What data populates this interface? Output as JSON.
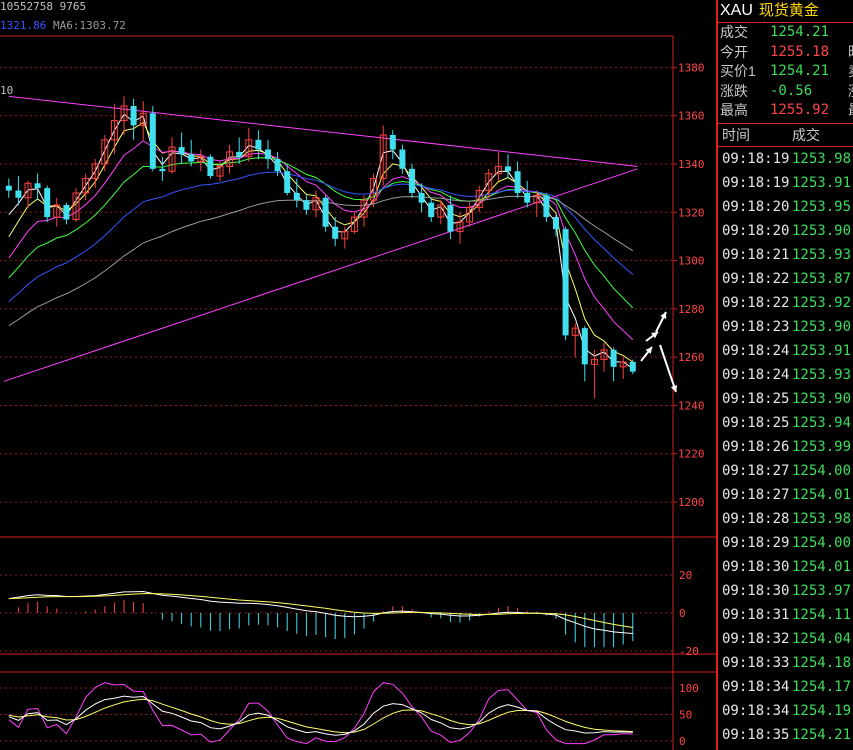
{
  "header": {
    "top_line": "10552758 9765",
    "ma_a_label": "1321.86",
    "ma_b_label": "MA6:1303.72",
    "corner_tag": "10"
  },
  "quote": {
    "code": "XAU",
    "name": "现货黄金",
    "rows": [
      {
        "label": "成交",
        "value": "1254.21",
        "color": "green",
        "clip": ""
      },
      {
        "label": "今开",
        "value": "1255.18",
        "color": "red",
        "clip": "昨"
      },
      {
        "label": "买价1",
        "value": "1254.21",
        "color": "green",
        "clip": "卖"
      },
      {
        "label": "涨跌",
        "value": "-0.56",
        "color": "green",
        "clip": "涨"
      },
      {
        "label": "最高",
        "value": "1255.92",
        "color": "red",
        "clip": "最"
      }
    ],
    "trade_headers": [
      "时间",
      "成交"
    ],
    "trades": [
      {
        "time": "09:18:19",
        "price": "1253.98"
      },
      {
        "time": "09:18:19",
        "price": "1253.91"
      },
      {
        "time": "09:18:20",
        "price": "1253.95"
      },
      {
        "time": "09:18:20",
        "price": "1253.90"
      },
      {
        "time": "09:18:21",
        "price": "1253.93"
      },
      {
        "time": "09:18:22",
        "price": "1253.87"
      },
      {
        "time": "09:18:22",
        "price": "1253.92"
      },
      {
        "time": "09:18:23",
        "price": "1253.90"
      },
      {
        "time": "09:18:24",
        "price": "1253.91"
      },
      {
        "time": "09:18:24",
        "price": "1253.93"
      },
      {
        "time": "09:18:25",
        "price": "1253.90"
      },
      {
        "time": "09:18:25",
        "price": "1253.94"
      },
      {
        "time": "09:18:26",
        "price": "1253.99"
      },
      {
        "time": "09:18:27",
        "price": "1254.00"
      },
      {
        "time": "09:18:27",
        "price": "1254.01"
      },
      {
        "time": "09:18:28",
        "price": "1253.98"
      },
      {
        "time": "09:18:29",
        "price": "1254.00"
      },
      {
        "time": "09:18:30",
        "price": "1254.01"
      },
      {
        "time": "09:18:30",
        "price": "1253.97"
      },
      {
        "time": "09:18:31",
        "price": "1254.11"
      },
      {
        "time": "09:18:32",
        "price": "1254.04"
      },
      {
        "time": "09:18:33",
        "price": "1254.18"
      },
      {
        "time": "09:18:34",
        "price": "1254.17"
      },
      {
        "time": "09:18:34",
        "price": "1254.19"
      },
      {
        "time": "09:18:35",
        "price": "1254.21"
      }
    ]
  },
  "chart_data": {
    "type": "candlestick",
    "price_ticks": [
      1380,
      1360,
      1340,
      1320,
      1300,
      1280,
      1260,
      1240,
      1220,
      1200
    ],
    "price_range": [
      1188,
      1393
    ],
    "macd_ticks": [
      20,
      0,
      -20
    ],
    "kdj_ticks": [
      100,
      50,
      0
    ],
    "colors": {
      "up": "#ff4040",
      "down": "#40e0f0",
      "grid": "#8b1a1a",
      "axis": "#d22222"
    },
    "candles": [
      [
        1331,
        1334,
        1326,
        1329
      ],
      [
        1329,
        1335,
        1323,
        1326
      ],
      [
        1326,
        1333,
        1322,
        1332
      ],
      [
        1332,
        1336,
        1325,
        1330
      ],
      [
        1330,
        1331,
        1316,
        1318
      ],
      [
        1318,
        1326,
        1314,
        1323
      ],
      [
        1323,
        1324,
        1315,
        1317
      ],
      [
        1317,
        1330,
        1316,
        1328
      ],
      [
        1328,
        1336,
        1325,
        1334
      ],
      [
        1334,
        1342,
        1330,
        1340
      ],
      [
        1340,
        1352,
        1337,
        1350
      ],
      [
        1350,
        1365,
        1344,
        1358
      ],
      [
        1358,
        1368,
        1352,
        1364
      ],
      [
        1364,
        1367,
        1350,
        1356
      ],
      [
        1356,
        1366,
        1350,
        1361
      ],
      [
        1361,
        1364,
        1337,
        1338
      ],
      [
        1338,
        1343,
        1333,
        1337
      ],
      [
        1337,
        1351,
        1336,
        1347
      ],
      [
        1347,
        1353,
        1340,
        1344
      ],
      [
        1344,
        1350,
        1339,
        1341
      ],
      [
        1341,
        1346,
        1337,
        1343
      ],
      [
        1343,
        1344,
        1334,
        1335
      ],
      [
        1335,
        1341,
        1333,
        1339
      ],
      [
        1339,
        1348,
        1336,
        1345
      ],
      [
        1345,
        1351,
        1340,
        1343
      ],
      [
        1343,
        1355,
        1341,
        1350
      ],
      [
        1350,
        1354,
        1342,
        1346
      ],
      [
        1346,
        1350,
        1338,
        1342
      ],
      [
        1342,
        1345,
        1335,
        1337
      ],
      [
        1337,
        1340,
        1327,
        1328
      ],
      [
        1328,
        1334,
        1322,
        1325
      ],
      [
        1325,
        1327,
        1319,
        1321
      ],
      [
        1321,
        1329,
        1318,
        1326
      ],
      [
        1326,
        1327,
        1312,
        1314
      ],
      [
        1314,
        1318,
        1306,
        1309
      ],
      [
        1309,
        1314,
        1305,
        1312
      ],
      [
        1312,
        1320,
        1311,
        1318
      ],
      [
        1318,
        1327,
        1314,
        1325
      ],
      [
        1325,
        1336,
        1322,
        1334
      ],
      [
        1334,
        1356,
        1331,
        1352
      ],
      [
        1352,
        1354,
        1342,
        1346
      ],
      [
        1346,
        1348,
        1336,
        1338
      ],
      [
        1338,
        1340,
        1326,
        1328
      ],
      [
        1328,
        1332,
        1320,
        1324
      ],
      [
        1324,
        1326,
        1316,
        1318
      ],
      [
        1318,
        1325,
        1315,
        1323
      ],
      [
        1323,
        1327,
        1309,
        1312
      ],
      [
        1312,
        1320,
        1307,
        1316
      ],
      [
        1316,
        1324,
        1314,
        1322
      ],
      [
        1322,
        1331,
        1320,
        1329
      ],
      [
        1329,
        1338,
        1326,
        1336
      ],
      [
        1336,
        1345,
        1333,
        1339
      ],
      [
        1339,
        1344,
        1334,
        1337
      ],
      [
        1337,
        1341,
        1326,
        1328
      ],
      [
        1328,
        1333,
        1322,
        1324
      ],
      [
        1324,
        1329,
        1318,
        1327
      ],
      [
        1327,
        1328,
        1316,
        1318
      ],
      [
        1318,
        1319,
        1310,
        1313
      ],
      [
        1313,
        1314,
        1267,
        1269
      ],
      [
        1269,
        1274,
        1260,
        1272
      ],
      [
        1272,
        1273,
        1250,
        1257
      ],
      [
        1257,
        1263,
        1243,
        1259
      ],
      [
        1259,
        1266,
        1254,
        1263
      ],
      [
        1263,
        1264,
        1250,
        1256
      ],
      [
        1256,
        1260,
        1251,
        1258
      ],
      [
        1258,
        1259,
        1253,
        1254
      ]
    ],
    "ma_lines": [
      {
        "color": "#ffffff"
      },
      {
        "color": "#ffff66"
      },
      {
        "color": "#ff40ff"
      },
      {
        "color": "#40ff40"
      },
      {
        "color": "#3355ff"
      },
      {
        "color": "#9a9a9a"
      }
    ],
    "trendlines": [
      {
        "from": [
          0,
          1368
        ],
        "to": [
          65.5,
          1339
        ],
        "color": "#ff40ff"
      },
      {
        "from": [
          -0.5,
          1250
        ],
        "to": [
          65.5,
          1338
        ],
        "color": "#ff40ff"
      }
    ]
  }
}
